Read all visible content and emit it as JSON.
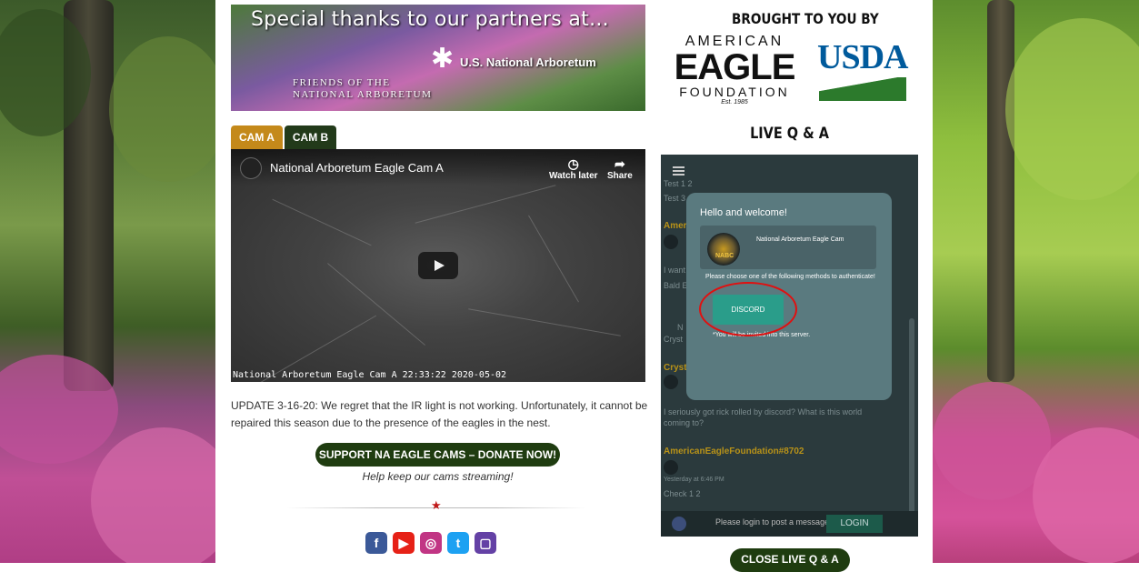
{
  "banner_left": {
    "thanks": "Special thanks to our partners at...",
    "friends_line1": "FRIENDS OF THE",
    "friends_line2": "NATIONAL ARBORETUM",
    "usna": "U.S. National Arboretum"
  },
  "banner_right": {
    "brought": "BROUGHT TO YOU BY",
    "aef_top": "AMERICAN",
    "aef_mid": "EAGLE",
    "aef_bottom": "FOUNDATION",
    "aef_est": "Est. 1985",
    "usda": "USDA"
  },
  "tabs": [
    {
      "label": "CAM A"
    },
    {
      "label": "CAM B"
    }
  ],
  "video": {
    "title": "National Arboretum Eagle Cam A",
    "watch_later": "Watch later",
    "share": "Share",
    "timestamp": "National Arboretum Eagle Cam A 22:33:22 2020-05-02"
  },
  "update_text": "UPDATE 3-16-20: We regret that the IR light is not working. Unfortunately, it cannot be repaired this season due to the presence of the eagles in the nest.",
  "donate_label": "SUPPORT NA EAGLE CAMS – DONATE NOW!",
  "help_keep": "Help keep our cams streaming!",
  "live_qa_title": "LIVE Q & A",
  "chat": {
    "messages": [
      {
        "text": "Test 1 2"
      },
      {
        "text": "Test 3 4"
      },
      {
        "text": "Ameri"
      },
      {
        "text": "I want"
      },
      {
        "text": "Bald E"
      },
      {
        "text": "N"
      },
      {
        "text": "Cryst"
      },
      {
        "text": "Crysta"
      },
      {
        "text": "I seriously got rick rolled by discord? What is this world coming to?"
      },
      {
        "text": "AmericanEagleFoundation#8702"
      },
      {
        "text": "Yesterday at 6:46 PM"
      },
      {
        "text": "Check 1 2"
      }
    ],
    "footer_msg": "Please login to post a message.",
    "login_label": "LOGIN"
  },
  "modal": {
    "hello": "Hello and welcome!",
    "server_name": "National Arboretum Eagle Cam",
    "server_avatar_text": "NABC",
    "choose": "Please choose one of the following methods to authenticate!",
    "discord_label": "DISCORD",
    "note": "*You will be invited into this server."
  },
  "close_qa_label": "CLOSE LIVE Q & A",
  "social": [
    {
      "icon": "facebook-icon",
      "glyph": "f",
      "color": "#3b5998"
    },
    {
      "icon": "youtube-icon",
      "glyph": "▶",
      "color": "#e62117"
    },
    {
      "icon": "instagram-icon",
      "glyph": "◎",
      "color": "#c13584"
    },
    {
      "icon": "twitter-icon",
      "glyph": "t",
      "color": "#1da1f2"
    },
    {
      "icon": "twitch-icon",
      "glyph": "▢",
      "color": "#6441a5"
    }
  ]
}
